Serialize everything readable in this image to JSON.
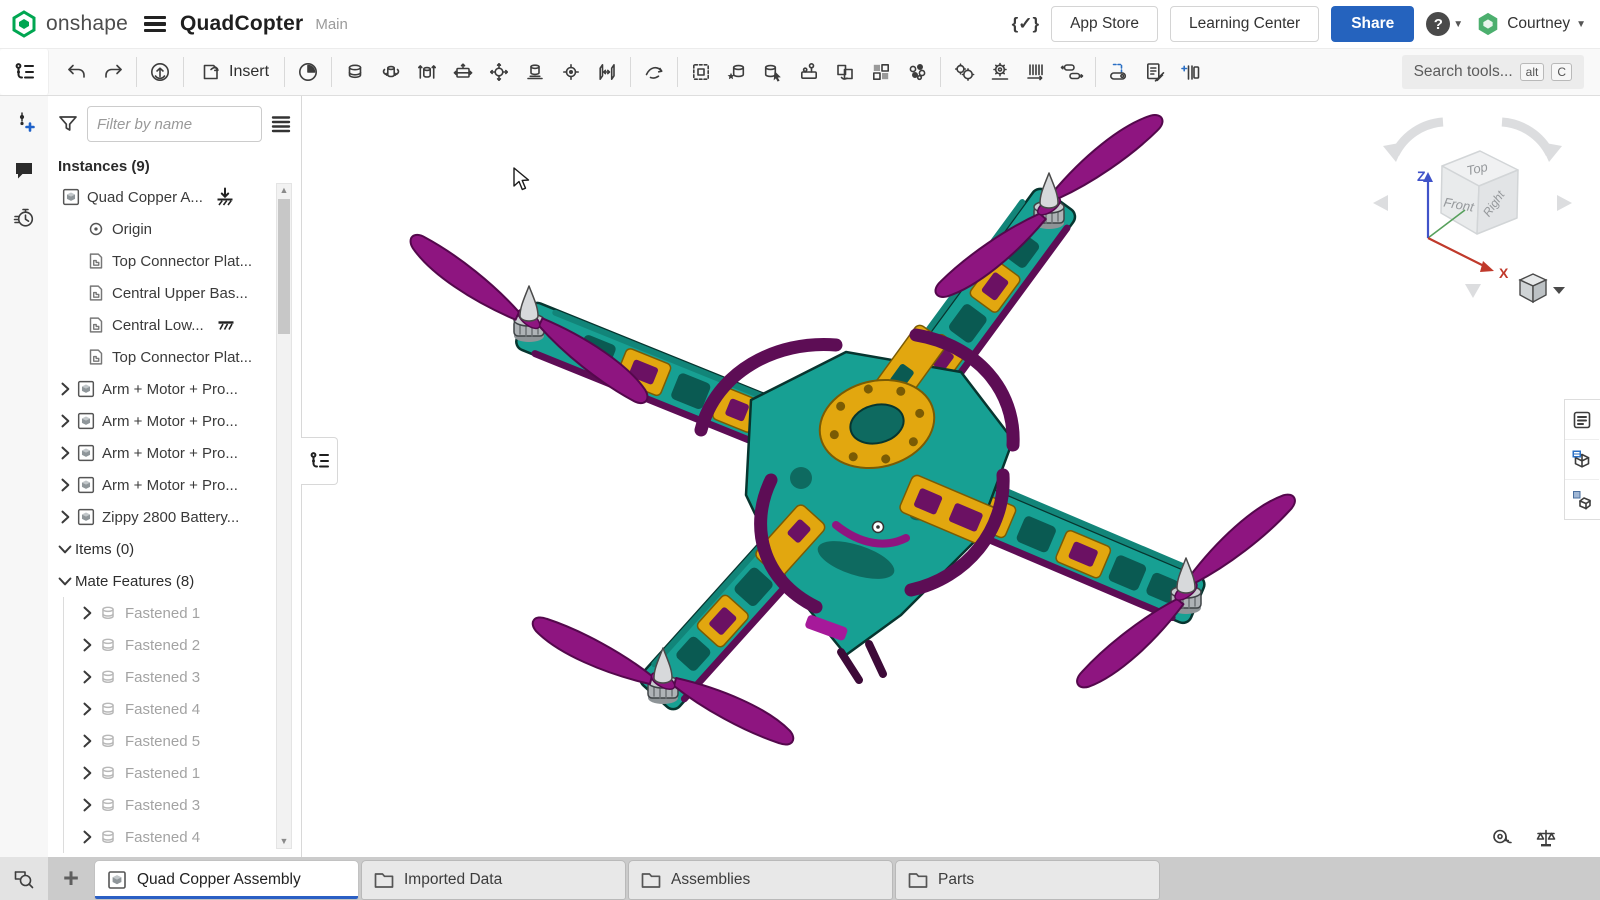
{
  "header": {
    "brand": "onshape",
    "doc_title": "QuadCopter",
    "workspace": "Main",
    "dev_badge": "{✓}",
    "app_store": "App Store",
    "learning_center": "Learning Center",
    "share": "Share",
    "help": "?",
    "user": "Courtney"
  },
  "toolbar": {
    "insert": "Insert",
    "search_placeholder": "Search tools...",
    "key_alt": "alt",
    "key_c": "C",
    "groups": [
      [
        "clock"
      ],
      [
        "mate-fastened",
        "mate-revolute",
        "mate-slider",
        "mate-planar",
        "mate-ball",
        "mate-cylindrical",
        "mate-pin-slot",
        "mate-parallel"
      ],
      [
        "tangent-relation"
      ],
      [
        "group-parts",
        "standard-content",
        "replace-instance",
        "named-positions",
        "transfer-copy",
        "exploded-view",
        "display-states"
      ],
      [
        "gear-relation",
        "gear-base",
        "rack-relation",
        "configuration-toggle"
      ],
      [
        "sheet-metal-flat",
        "bom-table",
        "frame-profiles"
      ]
    ]
  },
  "left_strip": {
    "icons": [
      "structure-tree",
      "create-version",
      "comments",
      "history"
    ]
  },
  "left_panel": {
    "filter_placeholder": "Filter by name",
    "instances_header": "Instances (9)",
    "instances": [
      {
        "label": "Quad Copper A...",
        "icon": "assembly",
        "suffix_icon": "grounded"
      },
      {
        "label": "Origin",
        "icon": "origin"
      },
      {
        "label": "Top Connector Plat...",
        "icon": "part"
      },
      {
        "label": "Central Upper Bas...",
        "icon": "part"
      },
      {
        "label": "Central Low...",
        "icon": "part",
        "suffix_icon": "fixed"
      },
      {
        "label": "Top Connector Plat...",
        "icon": "part"
      },
      {
        "label": "Arm + Motor + Pro...",
        "icon": "subassembly",
        "expandable": true
      },
      {
        "label": "Arm + Motor + Pro...",
        "icon": "subassembly",
        "expandable": true
      },
      {
        "label": "Arm + Motor + Pro...",
        "icon": "subassembly",
        "expandable": true
      },
      {
        "label": "Arm + Motor + Pro...",
        "icon": "subassembly",
        "expandable": true
      },
      {
        "label": "Zippy 2800 Battery...",
        "icon": "subassembly",
        "expandable": true
      }
    ],
    "items_header": "Items (0)",
    "mate_features_header": "Mate Features (8)",
    "mate_features": [
      "Fastened 1",
      "Fastened 2",
      "Fastened 3",
      "Fastened 4",
      "Fastened 5",
      "Fastened 1",
      "Fastened 3",
      "Fastened 4"
    ]
  },
  "viewport": {
    "view_cube": {
      "top": "Top",
      "front": "Front",
      "right": "Right",
      "axis_z": "Z",
      "axis_x": "X"
    }
  },
  "tab_bar": {
    "tabs": [
      {
        "label": "Quad Copper Assembly",
        "icon": "assembly",
        "active": true
      },
      {
        "label": "Imported Data",
        "icon": "folder",
        "active": false
      },
      {
        "label": "Assemblies",
        "icon": "folder",
        "active": false
      },
      {
        "label": "Parts",
        "icon": "folder",
        "active": false
      }
    ]
  },
  "colors": {
    "accent_blue": "#2563be",
    "tab_active_underline": "#2a5fc4",
    "brand_green": "#00a651",
    "frame_teal": "#17A093",
    "plate_gold": "#E2A70F",
    "guard_purple": "#6B1163",
    "prop_magenta": "#8E1580"
  }
}
